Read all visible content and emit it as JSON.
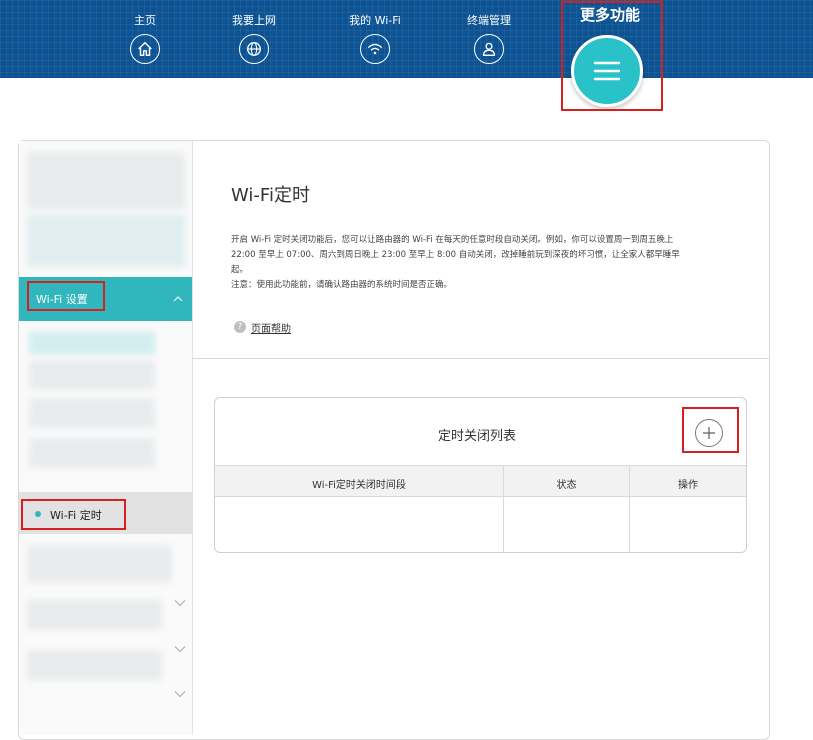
{
  "nav": {
    "items": [
      {
        "label": "主页",
        "icon": "home-icon"
      },
      {
        "label": "我要上网",
        "icon": "globe-icon"
      },
      {
        "label": "我的 Wi-Fi",
        "icon": "wifi-icon"
      },
      {
        "label": "终端管理",
        "icon": "user-icon"
      }
    ],
    "more": {
      "label": "更多功能",
      "icon": "menu-icon"
    }
  },
  "sidebar": {
    "active_section": "Wi-Fi 设置",
    "active_item": "Wi-Fi 定时"
  },
  "content": {
    "title": "Wi-Fi定时",
    "description_lines": [
      "开启 Wi-Fi 定时关闭功能后，您可以让路由器的 Wi-Fi 在每天的任意时段自动关闭。例如，你可以设置周一到周五晚上",
      "22:00 至早上 07:00、周六到周日晚上 23:00 至早上 8:00 自动关闭，改掉睡前玩到深夜的坏习惯，让全家人都早睡早",
      "起。",
      "注意：使用此功能前，请确认路由器的系统时间是否正确。"
    ],
    "help_label": "页面帮助",
    "help_icon_glyph": "?"
  },
  "list": {
    "title": "定时关闭列表",
    "columns": [
      "Wi-Fi定时关闭时间段",
      "状态",
      "操作"
    ]
  },
  "colors": {
    "nav_bg": "#0d5393",
    "accent": "#2fb7bd",
    "highlight_red": "#d6201f"
  }
}
